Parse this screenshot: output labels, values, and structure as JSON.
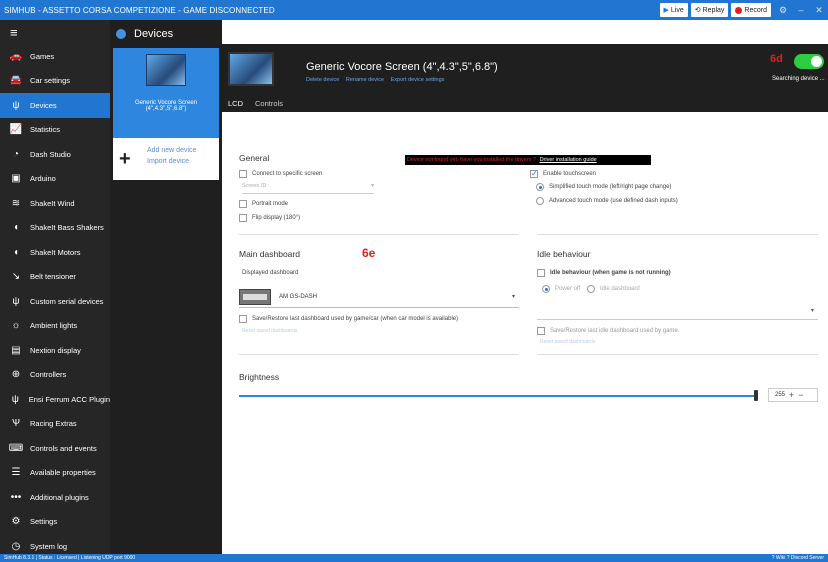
{
  "titlebar": {
    "title": "SIMHUB - ASSETTO CORSA COMPETIZIONE - GAME DISCONNECTED",
    "live": "Live",
    "replay": "Replay",
    "record": "Record"
  },
  "sidebar": {
    "items": [
      {
        "label": "Games",
        "icon": "car-front-icon"
      },
      {
        "label": "Car settings",
        "icon": "car-side-icon"
      },
      {
        "label": "Devices",
        "icon": "usb-icon"
      },
      {
        "label": "Statistics",
        "icon": "chart-icon"
      },
      {
        "label": "Dash Studio",
        "icon": "gauge-icon"
      },
      {
        "label": "Arduino",
        "icon": "board-icon"
      },
      {
        "label": "ShakeIt Wind",
        "icon": "wind-icon"
      },
      {
        "label": "ShakeIt Bass Shakers",
        "icon": "speaker-icon"
      },
      {
        "label": "ShakeIt Motors",
        "icon": "motor-icon"
      },
      {
        "label": "Belt tensioner",
        "icon": "belt-icon"
      },
      {
        "label": "Custom serial devices",
        "icon": "usb-icon"
      },
      {
        "label": "Ambient lights",
        "icon": "bulb-icon"
      },
      {
        "label": "Nextion display",
        "icon": "display-icon"
      },
      {
        "label": "Controllers",
        "icon": "gamepad-icon"
      },
      {
        "label": "Ensi Ferrum ACC Plugin",
        "icon": "usb-icon"
      },
      {
        "label": "Racing Extras",
        "icon": "extras-icon"
      },
      {
        "label": "Controls and events",
        "icon": "keyboard-icon"
      },
      {
        "label": "Available properties",
        "icon": "list-icon"
      },
      {
        "label": "Additional plugins",
        "icon": "dots-icon"
      },
      {
        "label": "Settings",
        "icon": "gear-icon"
      },
      {
        "label": "System log",
        "icon": "clock-icon"
      }
    ]
  },
  "devlist": {
    "header": "Devices",
    "device_name": "Generic Vocore Screen",
    "device_sizes": "(4\",4.3\",5\",6.8\")",
    "add_device": "Add new device",
    "import_device": "Import device"
  },
  "devhead": {
    "name": "Generic Vocore Screen (4\",4.3\",5\",6.8\")",
    "links": [
      "Delete device",
      "Rename device",
      "Export device settings"
    ],
    "badge": "6d",
    "searching": "Searching device ..."
  },
  "tabs": [
    "LCD",
    "Controls"
  ],
  "content": {
    "alert_text": "Device not found yet, have you installed the drivers ?",
    "alert_link": "Driver installation guide",
    "general_title": "General",
    "connect_specific": "Connect to specific screen",
    "screen_id_placeholder": "Screen ID :",
    "portrait": "Portrait mode",
    "flip": "Flip display (180°)",
    "enable_touch": "Enable touchscreen",
    "simplified_touch": "Simplified touch mode (left/right page change)",
    "advanced_touch": "Advanced touch mode (use defined dash inputs)",
    "main_dash_title": "Main dashboard",
    "annot_6e": "6e",
    "displayed_dash": "Displayed dashboard",
    "dash_value": "AM GS-DASH",
    "save_restore_main": "Save/Restore last dashboard used by game/car (when car model is available)",
    "reset_main": "Reset saved dashboards",
    "idle_title": "Idle behaviour",
    "idle_when": "Idle behaviour (when game is not running)",
    "power_off": "Power off",
    "idle_dashboard": "Idle dashboard",
    "save_restore_idle": "Save/Restore last idle dashboard used by game.",
    "reset_idle": "Reset saved dashboards",
    "brightness_title": "Brightness",
    "brightness_value": "255",
    "brightness_level": 1.0
  },
  "statusbar": {
    "left": "SimHub 8.3.1 | Status : Licensed | Listening UDP port 9000",
    "right": "? Wiki   ? Discord Server"
  },
  "colors": {
    "accent": "#2176d2",
    "sidebar_bg": "#262626",
    "alert": "#e0201a",
    "toggle_on": "#2ecc40"
  }
}
